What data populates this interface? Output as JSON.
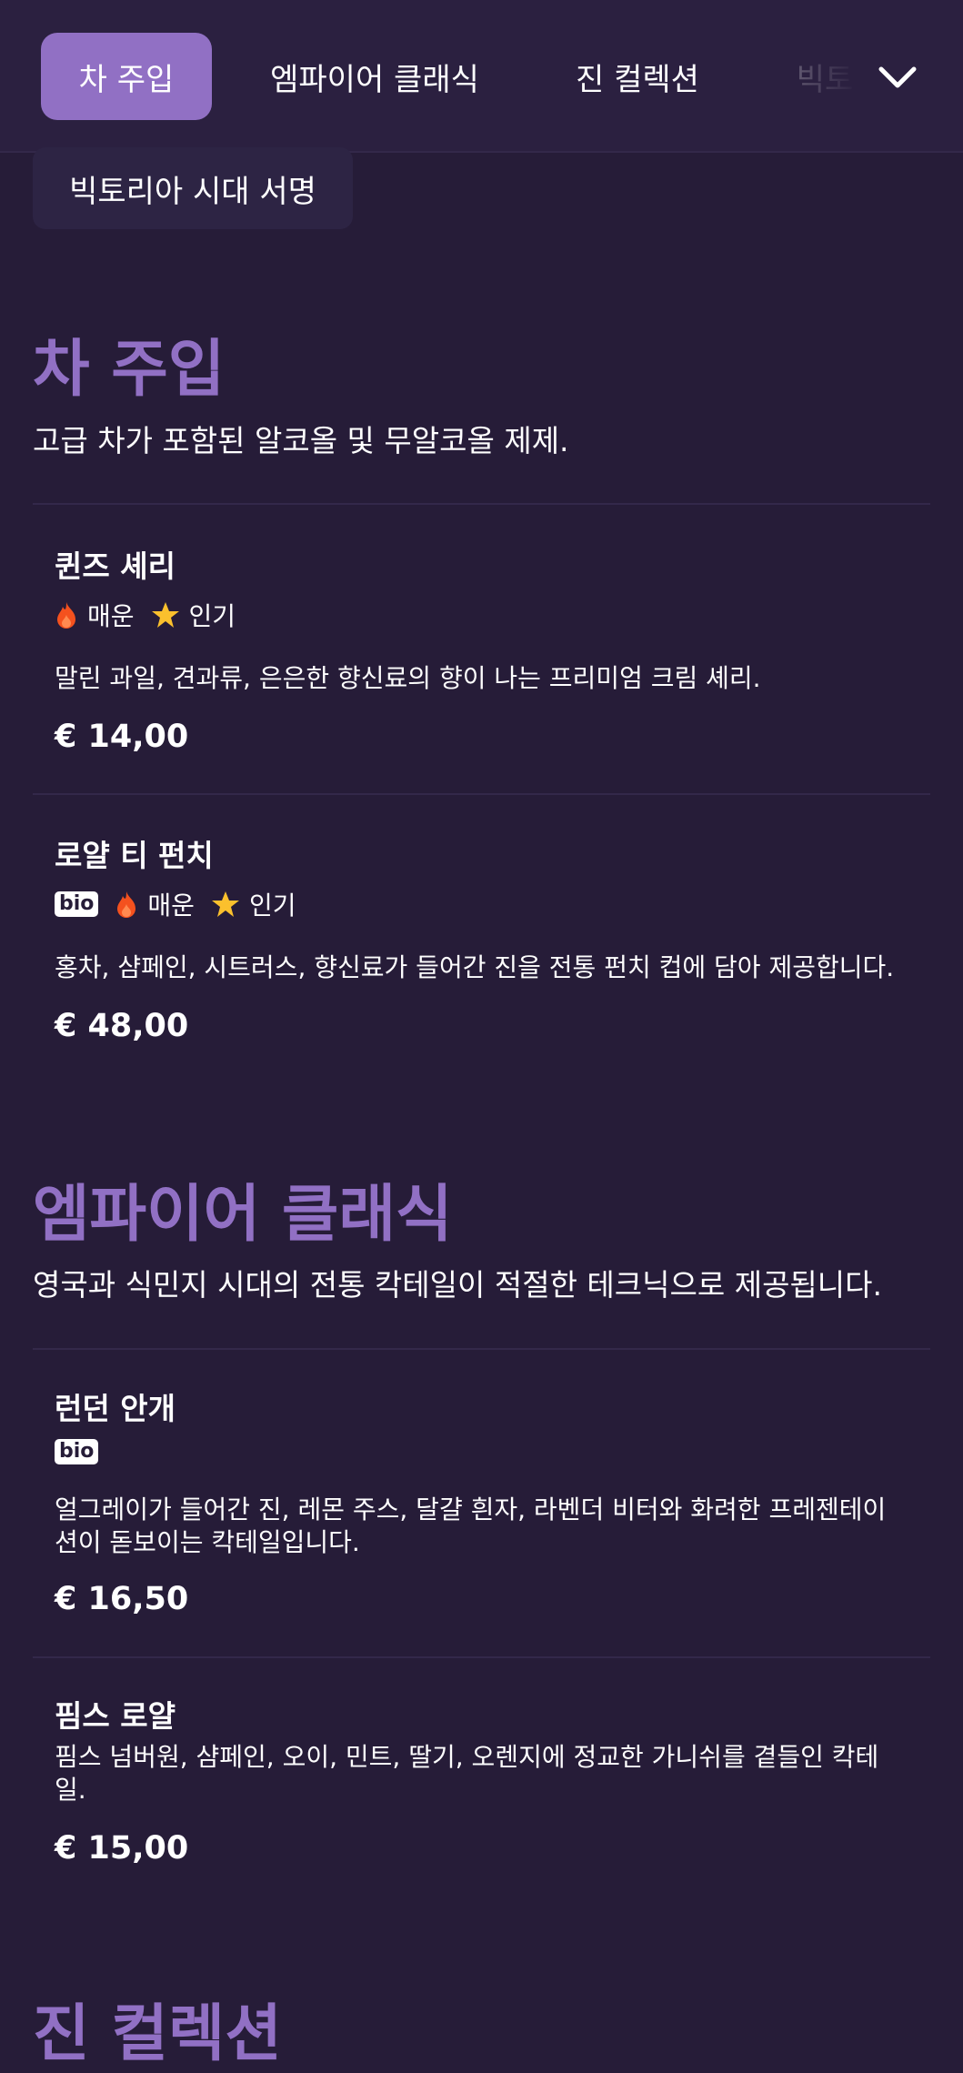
{
  "nav": {
    "tabs": [
      {
        "label": "차 주입",
        "active": true
      },
      {
        "label": "엠파이어 클래식",
        "active": false
      },
      {
        "label": "진 컬렉션",
        "active": false
      },
      {
        "label": "빅토",
        "active": false
      }
    ],
    "overflow_tab": "빅토리아 시대 서명",
    "expand_icon": "chevron-down-icon"
  },
  "sections": [
    {
      "title": "차 주입",
      "description": "고급 차가 포함된 알코올 및 무알코올 제제.",
      "items": [
        {
          "name": "퀸즈 셰리",
          "tags": {
            "bio": "",
            "spicy": "매운",
            "popular": "인기"
          },
          "description": "말린 과일, 견과류, 은은한 향신료의 향이 나는 프리미엄 크림 셰리.",
          "price": "€ 14,00"
        },
        {
          "name": "로얄 티 펀치",
          "tags": {
            "bio": "bio",
            "spicy": "매운",
            "popular": "인기"
          },
          "description": "홍차, 샴페인, 시트러스, 향신료가 들어간 진을 전통 펀치 컵에 담아 제공합니다.",
          "price": "€ 48,00"
        }
      ]
    },
    {
      "title": "엠파이어 클래식",
      "description": "영국과 식민지 시대의 전통 칵테일이 적절한 테크닉으로 제공됩니다.",
      "items": [
        {
          "name": "런던 안개",
          "tags": {
            "bio": "bio"
          },
          "description": "얼그레이가 들어간 진, 레몬 주스, 달걀 흰자, 라벤더 비터와 화려한 프레젠테이션이 돋보이는 칵테일입니다.",
          "price": "€ 16,50"
        },
        {
          "name": "핌스 로얄",
          "description": "핌스 넘버원, 샴페인, 오이, 민트, 딸기, 오렌지에 정교한 가니쉬를 곁들인 칵테일.",
          "price": "€ 15,00"
        }
      ]
    },
    {
      "title": "진 컬렉션"
    }
  ],
  "colors": {
    "background": "#261c38",
    "accent": "#9170c4",
    "flame": "#f4511e",
    "star": "#fbc02d"
  }
}
